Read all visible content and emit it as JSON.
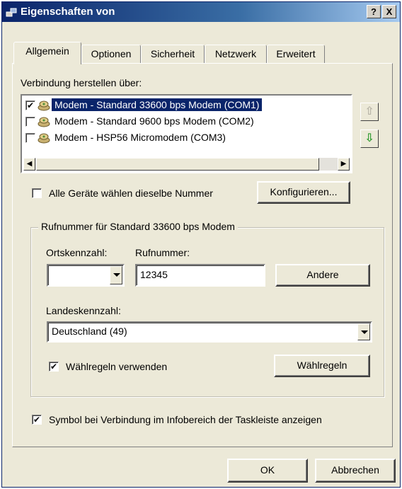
{
  "window": {
    "title": "Eigenschaften von",
    "help_label": "?",
    "close_label": "X"
  },
  "tabs": [
    {
      "label": "Allgemein",
      "active": true
    },
    {
      "label": "Optionen",
      "active": false
    },
    {
      "label": "Sicherheit",
      "active": false
    },
    {
      "label": "Netzwerk",
      "active": false
    },
    {
      "label": "Erweitert",
      "active": false
    }
  ],
  "connect": {
    "label": "Verbindung herstellen über:",
    "devices": [
      {
        "label": "Modem - Standard 33600 bps Modem (COM1)",
        "checked": true,
        "selected": true
      },
      {
        "label": "Modem - Standard  9600 bps Modem (COM2)",
        "checked": false,
        "selected": false
      },
      {
        "label": "Modem - HSP56 Micromodem (COM3)",
        "checked": false,
        "selected": false
      }
    ]
  },
  "same_number": {
    "label": "Alle Geräte wählen dieselbe Nummer",
    "checked": false
  },
  "configure_label": "Konfigurieren...",
  "phone": {
    "group_title": "Rufnummer für Standard 33600 bps Modem",
    "area_code_label": "Ortskennzahl:",
    "area_code_value": "",
    "number_label": "Rufnummer:",
    "number_value": "12345",
    "other_label": "Andere",
    "country_label": "Landeskennzahl:",
    "country_value": "Deutschland (49)",
    "use_rules_label": "Wählregeln verwenden",
    "use_rules_checked": true,
    "rules_button_label": "Wählregeln"
  },
  "tray": {
    "label": "Symbol bei Verbindung im Infobereich der Taskleiste anzeigen",
    "checked": true
  },
  "footer": {
    "ok_label": "OK",
    "cancel_label": "Abbrechen"
  },
  "colors": {
    "selection": "#0a246a",
    "title_start": "#0a246a",
    "dialog_bg": "#ece9d8",
    "arrow_green": "#2e9a2e"
  },
  "check_glyph": "✔"
}
